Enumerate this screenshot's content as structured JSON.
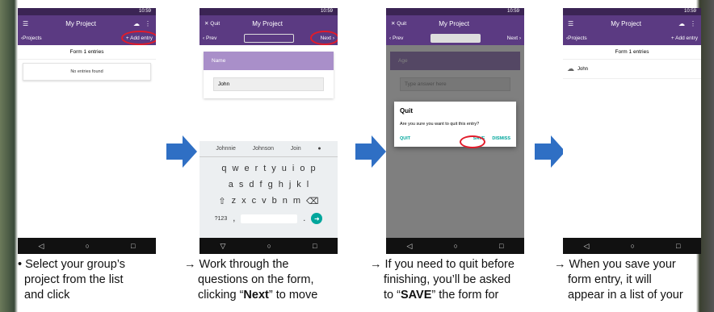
{
  "status_time": "10:59",
  "project_title": "My Project",
  "panel1": {
    "back": "Projects",
    "add": "+ Add entry",
    "heading": "Form 1 entries",
    "empty": "No entries found"
  },
  "panel2": {
    "quit": "Quit",
    "prev": "Prev",
    "next": "Next",
    "question": "Name",
    "answer": "John",
    "suggestions": [
      "Johnnie",
      "Johnson",
      "Join"
    ],
    "row1": [
      "q",
      "w",
      "e",
      "r",
      "t",
      "y",
      "u",
      "i",
      "o",
      "p"
    ],
    "row2": [
      "a",
      "s",
      "d",
      "f",
      "g",
      "h",
      "j",
      "k",
      "l"
    ],
    "row3": [
      "z",
      "x",
      "c",
      "v",
      "b",
      "n",
      "m"
    ],
    "symbols": "?123"
  },
  "panel3": {
    "quit": "Quit",
    "prev": "Prev",
    "next": "Next",
    "question": "Age",
    "placeholder": "Type answer here",
    "dialog_title": "Quit",
    "dialog_text": "Are you sure you want to quit this entry?",
    "btn_quit": "QUIT",
    "btn_save": "SAVE",
    "btn_dismiss": "DISMISS"
  },
  "panel4": {
    "back": "Projects",
    "add": "+ Add entry",
    "heading": "Form 1 entries",
    "entry": "John"
  },
  "captions": {
    "c1_lines": [
      "Select your group’s",
      "project from the list",
      "and click"
    ],
    "c2_l1": "→ Work through the",
    "c2_l2": "questions on the form,",
    "c2_l3a": "clicking “",
    "c2_l3b": "Next",
    "c2_l3c": "” to move",
    "c3_l1": "→ If you need to quit before",
    "c3_l2": "finishing, you’ll be asked",
    "c3_l3a": "to “",
    "c3_l3b": "SAVE",
    "c3_l3c": "” the form for",
    "c4_l1": "→ When you save your",
    "c4_l2": "form entry, it will",
    "c4_l3": "appear in a list of your"
  },
  "colors": {
    "purple": "#5b3a82",
    "accent": "#00a69c",
    "highlight": "#e21b2a",
    "arrow": "#2f6fc4"
  }
}
